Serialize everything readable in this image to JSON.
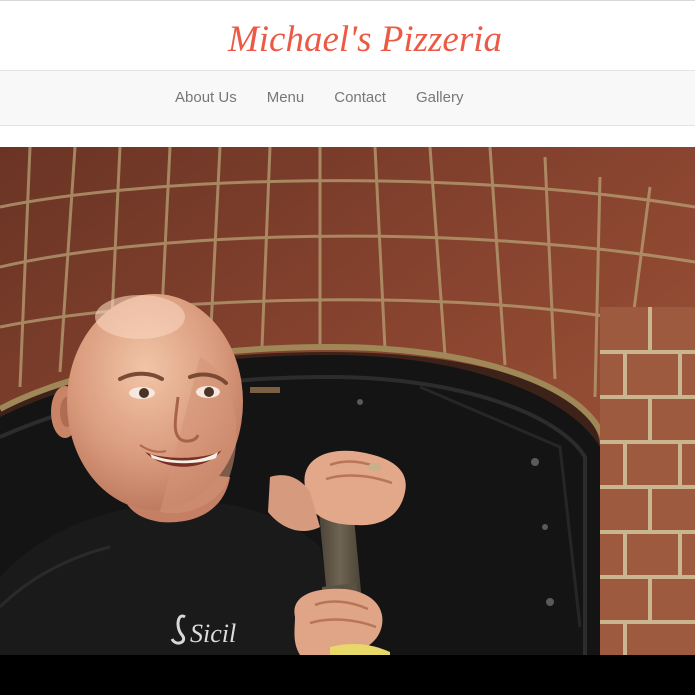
{
  "header": {
    "title": "Michael's Pizzeria"
  },
  "nav": {
    "items": [
      {
        "label": "About Us"
      },
      {
        "label": "Menu"
      },
      {
        "label": "Contact"
      },
      {
        "label": "Gallery"
      }
    ]
  },
  "hero": {
    "image_icon": "photo-chef-at-brick-oven",
    "apron_text": "Sicil"
  },
  "colors": {
    "brand": "#ec5a45",
    "nav_text": "#777777",
    "nav_background": "#f8f8f8"
  }
}
